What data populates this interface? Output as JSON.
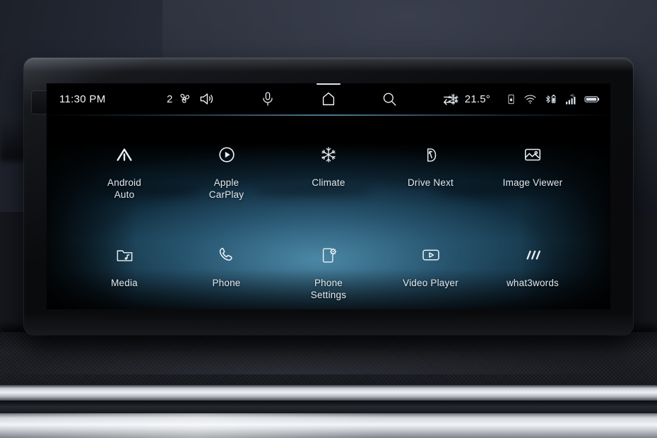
{
  "device": {
    "type": "car-infotainment-head-unit",
    "screen_state": "home-menu"
  },
  "statusbar": {
    "clock": "11:30 PM",
    "fan_level": "2",
    "fan_icon": "fan-icon",
    "cabin_temp": "21.5°",
    "climate_icon": "snowflake-icon",
    "nav_buttons": [
      {
        "name": "volume-speaker-button",
        "icon": "speaker-volume-icon"
      },
      {
        "name": "voice-assistant-button",
        "icon": "microphone-icon"
      },
      {
        "name": "home-button",
        "icon": "home-icon",
        "active": true
      },
      {
        "name": "search-button",
        "icon": "search-icon"
      },
      {
        "name": "back-button",
        "icon": "back-arrow-icon"
      }
    ],
    "right_icons": [
      {
        "name": "device-connection-icon",
        "icon": "phone-link-icon"
      },
      {
        "name": "wifi-icon",
        "icon": "wifi-icon"
      },
      {
        "name": "bluetooth-battery-icon",
        "icon": "bluetooth-device-battery-icon"
      },
      {
        "name": "cellular-signal-icon",
        "icon": "signal-bars-4g-icon",
        "network": "4G"
      },
      {
        "name": "battery-icon",
        "icon": "battery-full-icon"
      }
    ]
  },
  "apps": {
    "row1": [
      {
        "label": "Android\nAuto",
        "icon": "android-auto-icon"
      },
      {
        "label": "Apple\nCarPlay",
        "icon": "apple-carplay-icon"
      },
      {
        "label": "Climate",
        "icon": "snowflake-icon"
      },
      {
        "label": "Drive Next",
        "icon": "drive-next-icon"
      },
      {
        "label": "Image Viewer",
        "icon": "image-viewer-icon"
      }
    ],
    "row2": [
      {
        "label": "Media",
        "icon": "music-folder-icon"
      },
      {
        "label": "Phone",
        "icon": "phone-handset-icon"
      },
      {
        "label": "Phone\nSettings",
        "icon": "phone-settings-icon"
      },
      {
        "label": "Video Player",
        "icon": "video-player-icon"
      },
      {
        "label": "what3words",
        "icon": "what3words-slashes-icon"
      }
    ]
  },
  "colors": {
    "screen_glow": "#4e8caa",
    "text": "#e2e9ef",
    "accent_line": "#6ca8cd",
    "bezel": "#0a0b0d"
  }
}
